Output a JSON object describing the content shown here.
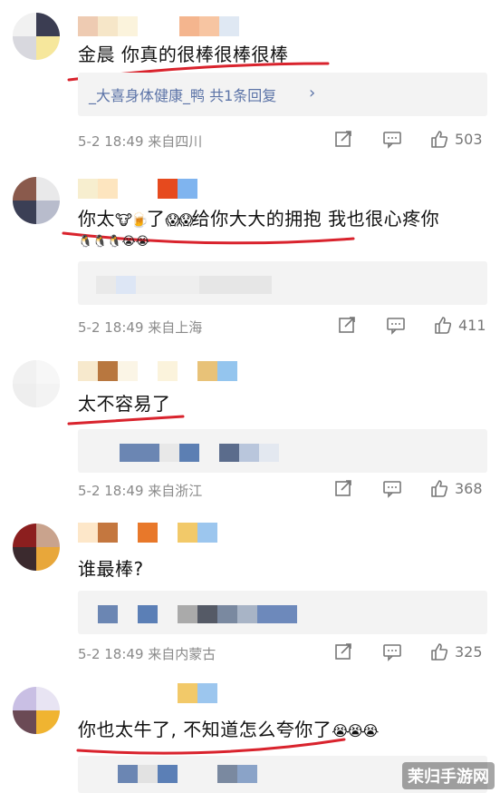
{
  "comments": [
    {
      "text": "金晨 你真的很棒很棒很棒",
      "reply_text": "_大喜身体健康_鸭  共1条回复",
      "reply_chevron": "›",
      "date": "5-2 18:49",
      "location": "来自四川",
      "likes": "503"
    },
    {
      "text_a": "你太",
      "emoji_a": "🐮🍺",
      "text_b": "了",
      "emoji_b": "😱😱",
      "text_c": "给你大大的拥抱 我也很心疼你",
      "mini_emoji": "🐧🐧🐧😭😭",
      "date": "5-2 18:49",
      "location": "来自上海",
      "likes": "411"
    },
    {
      "text": "太不容易了",
      "date": "5-2 18:49",
      "location": "来自浙江",
      "likes": "368"
    },
    {
      "text": "谁最棒?",
      "date": "5-2 18:49",
      "location": "来自内蒙古",
      "likes": "325"
    },
    {
      "text": "你也太牛了, 不知道怎么夸你了",
      "emoji": "😭😭😭"
    }
  ],
  "watermark": "茉归手游网",
  "colors": {
    "underline": "#d9232d",
    "link": "#5b73a7",
    "meta": "#8a8a8a",
    "reply_bg": "#f3f3f3"
  },
  "icons": [
    "share-icon",
    "comment-icon",
    "like-icon"
  ]
}
